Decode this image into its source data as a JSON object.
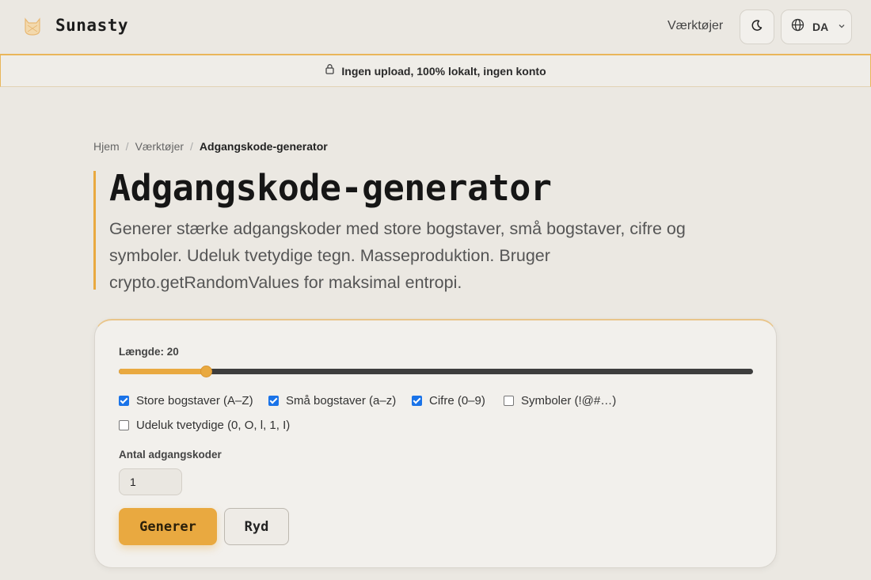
{
  "header": {
    "brand": "Sunasty",
    "nav_tools": "Værktøjer",
    "lang_code": "DA",
    "logo_icon": "cat-logo-icon",
    "theme_icon": "moon-icon",
    "lang_icon": "globe-icon",
    "lang_chevron_icon": "chevron-down-icon"
  },
  "notice": {
    "icon": "lock-icon",
    "text": "Ingen upload, 100% lokalt, ingen konto"
  },
  "breadcrumb": {
    "items": [
      "Hjem",
      "Værktøjer",
      "Adgangskode-generator"
    ],
    "separator": "/"
  },
  "page": {
    "title": "Adgangskode-generator",
    "description": "Generer stærke adgangskoder med store bogstaver, små bogstaver, cifre og symboler. Udeluk tvetydige tegn. Masseproduktion. Bruger crypto.getRandomValues for maksimal entropi."
  },
  "generator": {
    "length_label": "Længde: 20",
    "length_value": 20,
    "length_fraction": 0.137,
    "options": [
      {
        "label": "Store bogstaver (A–Z)",
        "checked": true
      },
      {
        "label": "Små bogstaver (a–z)",
        "checked": true
      },
      {
        "label": "Cifre (0–9)",
        "checked": true
      },
      {
        "label": "Symboler (!@#…)",
        "checked": false
      },
      {
        "label": "Udeluk tvetydige (0, O, l, 1, I)",
        "checked": false
      }
    ],
    "count_label": "Antal adgangskoder",
    "count_value": "1",
    "generate_label": "Generer",
    "clear_label": "Ryd"
  },
  "colors": {
    "accent": "#e9a940",
    "background": "#ebe8e2",
    "checkbox": "#1a73e8"
  }
}
